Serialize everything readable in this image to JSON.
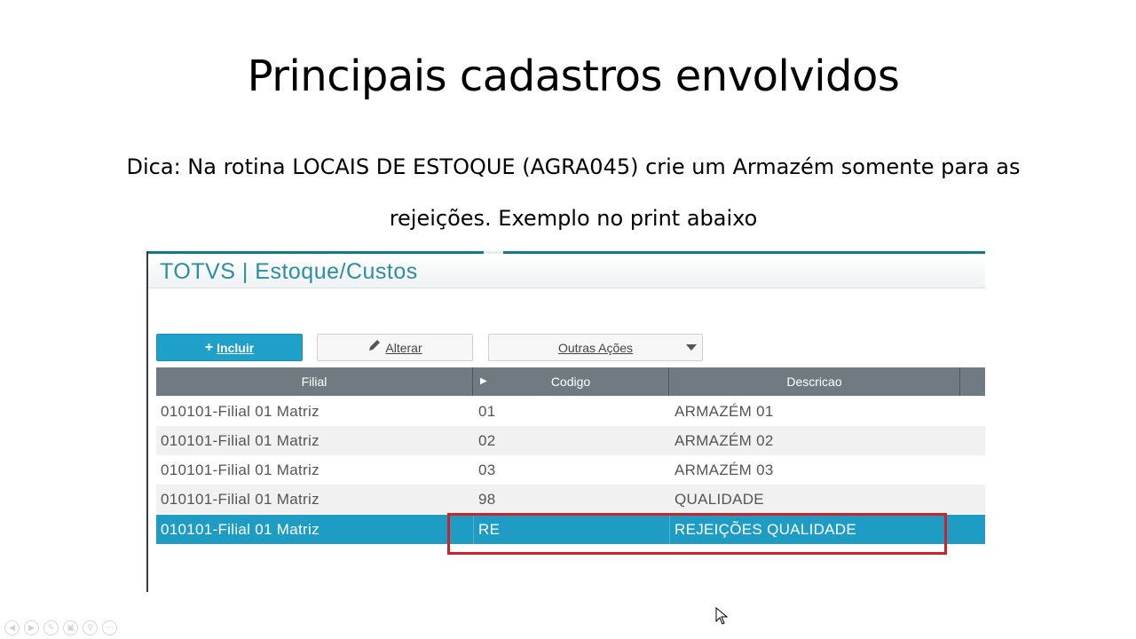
{
  "slide": {
    "title": "Principais cadastros envolvidos",
    "tip_line1": "Dica: Na rotina LOCAIS DE ESTOQUE (AGRA045) crie um Armazém somente para as",
    "tip_line2": "rejeições. Exemplo no print abaixo"
  },
  "app": {
    "title": "TOTVS | Estoque/Custos",
    "accent_color": "#2b8ea3",
    "toolbar": {
      "incluir_label": "Incluir",
      "alterar_label": "Alterar",
      "outras_label": "Outras Ações"
    },
    "grid": {
      "columns": [
        "Filial",
        "Codigo",
        "Descricao"
      ],
      "rows": [
        {
          "filial": "010101-Filial 01 Matriz",
          "codigo": "01",
          "descricao": "ARMAZÉM 01"
        },
        {
          "filial": "010101-Filial 01 Matriz",
          "codigo": "02",
          "descricao": "ARMAZÉM 02"
        },
        {
          "filial": "010101-Filial 01 Matriz",
          "codigo": "03",
          "descricao": "ARMAZÉM 03"
        },
        {
          "filial": "010101-Filial 01 Matriz",
          "codigo": "98",
          "descricao": "QUALIDADE"
        },
        {
          "filial": "010101-Filial 01 Matriz",
          "codigo": "RE",
          "descricao": "REJEIÇÕES QUALIDADE"
        }
      ],
      "selected_row_color": "#1e9cc4",
      "highlight_color": "#d0202a"
    }
  },
  "icons": {
    "plus": "plus-icon",
    "pencil": "pencil-icon",
    "dropdown": "chevron-down-icon",
    "sort": "sort-arrow-icon"
  }
}
